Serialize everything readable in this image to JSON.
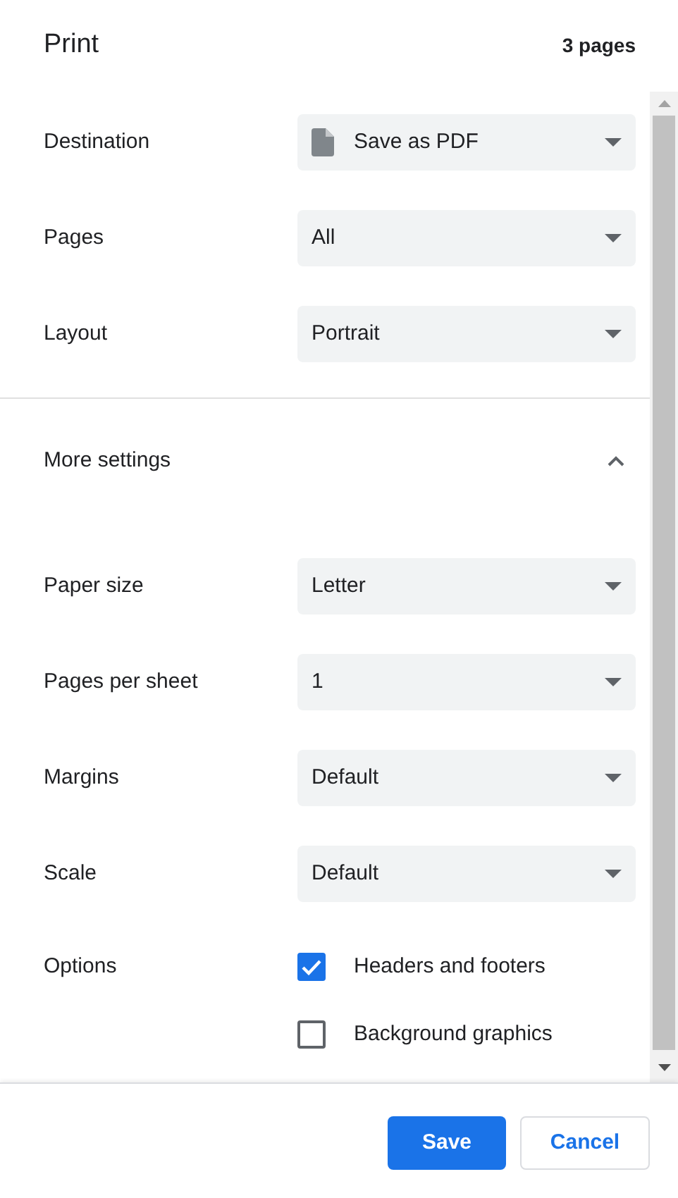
{
  "header": {
    "title": "Print",
    "page_count": "3 pages"
  },
  "settings": [
    {
      "label": "Destination",
      "kind": "file_select",
      "value": "Save as PDF"
    },
    {
      "label": "Pages",
      "kind": "select",
      "value": "All"
    },
    {
      "label": "Layout",
      "kind": "select",
      "value": "Portrait"
    }
  ],
  "more_settings": {
    "label": "More settings",
    "expanded": true
  },
  "advanced_settings": [
    {
      "label": "Paper size",
      "kind": "select",
      "value": "Letter"
    },
    {
      "label": "Pages per sheet",
      "kind": "select",
      "value": "1"
    },
    {
      "label": "Margins",
      "kind": "select",
      "value": "Default"
    },
    {
      "label": "Scale",
      "kind": "select",
      "value": "Default"
    },
    {
      "label": "Options",
      "kind": "checkboxes",
      "checkboxes": [
        {
          "label": "Headers and footers",
          "checked": true
        },
        {
          "label": "Background graphics",
          "checked": false
        }
      ]
    }
  ],
  "buttons": [
    {
      "label": "Save",
      "kind": "primary"
    },
    {
      "label": "Cancel",
      "kind": "secondary"
    }
  ]
}
